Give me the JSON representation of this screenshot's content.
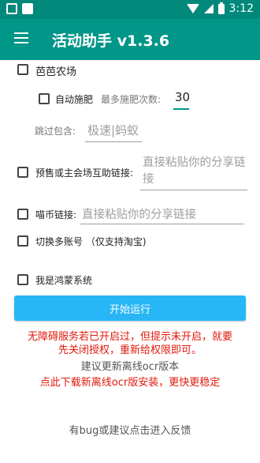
{
  "status_bar": {
    "time": "3:12",
    "icons": [
      "notification-icon",
      "image-icon",
      "wifi-icon",
      "signal-icon",
      "battery-icon"
    ]
  },
  "app_bar": {
    "title": "活动助手 v1.3.6",
    "menu_icon": "hamburger-menu-icon"
  },
  "farm": {
    "label": "芭芭农场",
    "auto_fertilize_label": "自动施肥",
    "max_times_label": "最多施肥次数:",
    "max_times_value": "30",
    "skip_label": "跳过包含:",
    "skip_placeholder": "极速|蚂蚁"
  },
  "presale": {
    "label": "预售或主会场互助链接:",
    "placeholder": "直接粘贴你的分享链接"
  },
  "coin": {
    "label": "喵币链接:",
    "placeholder": "直接粘贴你的分享链接"
  },
  "multi_account_label": "切换多账号 （仅支持淘宝)",
  "harmony_label": "我是鸿蒙系统",
  "run_button": "开始运行",
  "warning_line1": "无障碍服务若已开启过，但提示未开启，就要",
  "warning_line2": "先关闭授权，重新给权限即可。",
  "ocr_hint": "建议更新离线ocr版本",
  "download_link": "点此下载新离线ocr版安装，更快更稳定",
  "feedback_link": "有bug或建议点击进入反馈",
  "colors": {
    "status_bar": "#00897b",
    "app_bar": "#009688",
    "run_button": "#29b6f6",
    "warning": "#e0190b"
  }
}
